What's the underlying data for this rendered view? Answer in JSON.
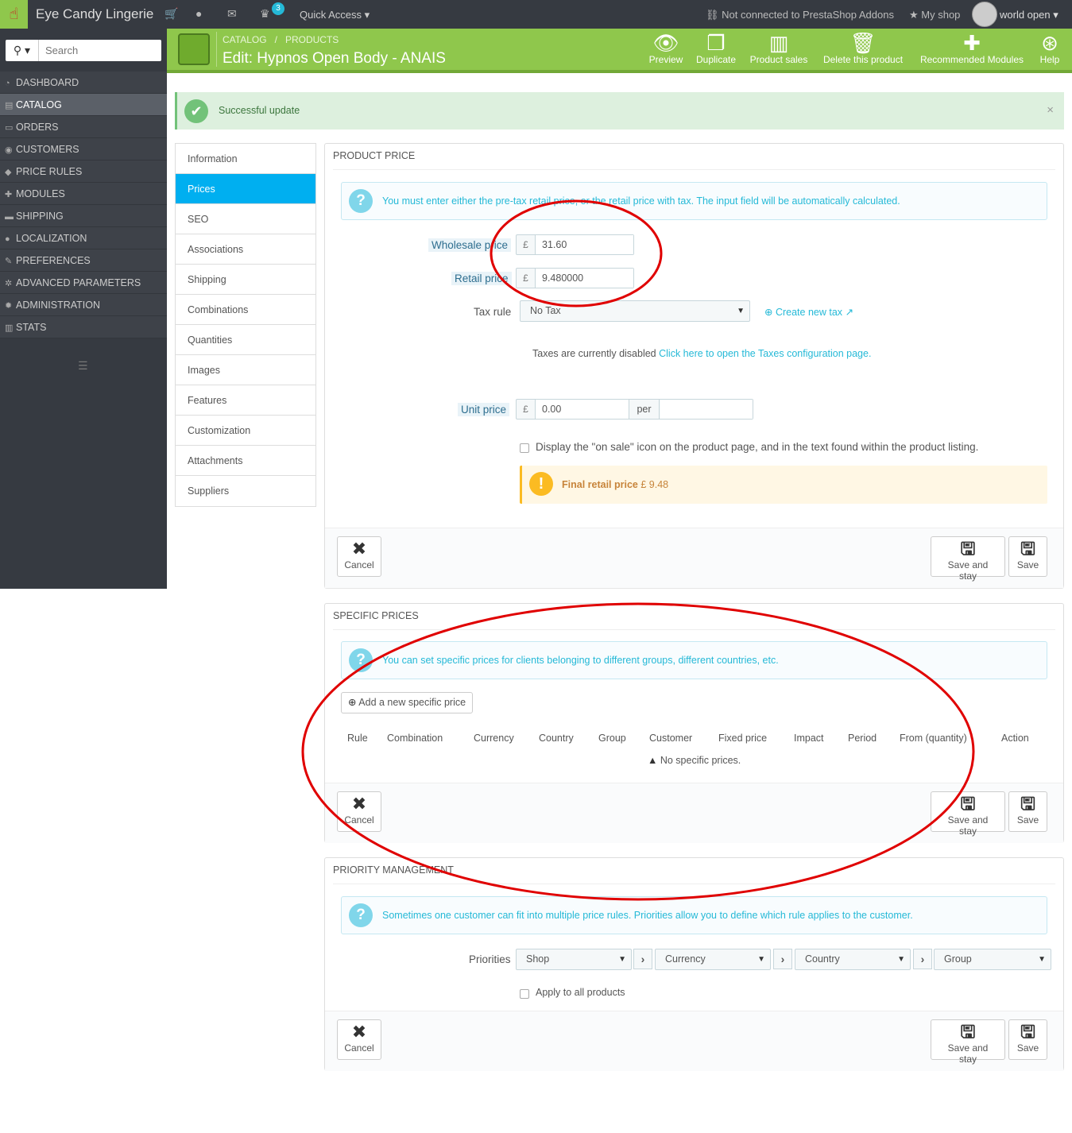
{
  "topbar": {
    "shop_name": "Eye Candy Lingerie",
    "badge_count": "3",
    "quick_access": "Quick Access",
    "addons_status": "Not connected to PrestaShop Addons",
    "my_shop": "My shop",
    "user": "world open"
  },
  "sidebar": {
    "search_placeholder": "Search",
    "items": [
      {
        "label": "DASHBOARD",
        "icon": "dashboard-icon"
      },
      {
        "label": "CATALOG",
        "icon": "book-icon"
      },
      {
        "label": "ORDERS",
        "icon": "credit-card-icon"
      },
      {
        "label": "CUSTOMERS",
        "icon": "users-icon"
      },
      {
        "label": "PRICE RULES",
        "icon": "tags-icon"
      },
      {
        "label": "MODULES",
        "icon": "puzzle-icon"
      },
      {
        "label": "SHIPPING",
        "icon": "truck-icon"
      },
      {
        "label": "LOCALIZATION",
        "icon": "globe-icon"
      },
      {
        "label": "PREFERENCES",
        "icon": "wrench-icon"
      },
      {
        "label": "ADVANCED PARAMETERS",
        "icon": "cogs-icon"
      },
      {
        "label": "ADMINISTRATION",
        "icon": "cog-icon"
      },
      {
        "label": "STATS",
        "icon": "bar-chart-icon"
      }
    ]
  },
  "header": {
    "breadcrumb_1": "CATALOG",
    "breadcrumb_sep": "/",
    "breadcrumb_2": "PRODUCTS",
    "title": "Edit: Hypnos Open Body - ANAIS",
    "toolbar": {
      "preview": "Preview",
      "duplicate": "Duplicate",
      "product_sales": "Product sales",
      "delete": "Delete this product",
      "recommended": "Recommended Modules",
      "help": "Help"
    }
  },
  "alert": {
    "text": "Successful update",
    "close": "×"
  },
  "tabs": [
    "Information",
    "Prices",
    "SEO",
    "Associations",
    "Shipping",
    "Combinations",
    "Quantities",
    "Images",
    "Features",
    "Customization",
    "Attachments",
    "Suppliers"
  ],
  "product_price": {
    "heading": "PRODUCT PRICE",
    "info": "You must enter either the pre-tax retail price, or the retail price with tax. The input field will be automatically calculated.",
    "wholesale_label": "Wholesale price",
    "wholesale_value": "31.60",
    "retail_label": "Retail price",
    "retail_value": "9.480000",
    "currency_symbol": "£",
    "tax_rule_label": "Tax rule",
    "tax_rule_value": "No Tax",
    "create_tax": "Create new tax",
    "taxes_disabled": "Taxes are currently disabled",
    "taxes_link": "Click here to open the Taxes configuration page.",
    "unit_price_label": "Unit price",
    "unit_price_value": "0.00",
    "per": "per",
    "on_sale_text": "Display the \"on sale\" icon on the product page, and in the text found within the product listing.",
    "final_label": "Final retail price",
    "final_value": "£ 9.48"
  },
  "specific_prices": {
    "heading": "SPECIFIC PRICES",
    "info": "You can set specific prices for clients belonging to different groups, different countries, etc.",
    "add_button": "Add a new specific price",
    "columns": [
      "Rule",
      "Combination",
      "Currency",
      "Country",
      "Group",
      "Customer",
      "Fixed price",
      "Impact",
      "Period",
      "From (quantity)",
      "Action"
    ],
    "empty": "No specific prices."
  },
  "priority": {
    "heading": "PRIORITY MANAGEMENT",
    "info": "Sometimes one customer can fit into multiple price rules. Priorities allow you to define which rule applies to the customer.",
    "label": "Priorities",
    "selects": [
      "Shop",
      "Currency",
      "Country",
      "Group"
    ],
    "apply_all": "Apply to all products"
  },
  "buttons": {
    "cancel": "Cancel",
    "save_stay": "Save and stay",
    "save": "Save"
  },
  "colors": {
    "accent": "#8fc74c",
    "active_tab": "#00aff0",
    "annotation": "#e00000"
  }
}
